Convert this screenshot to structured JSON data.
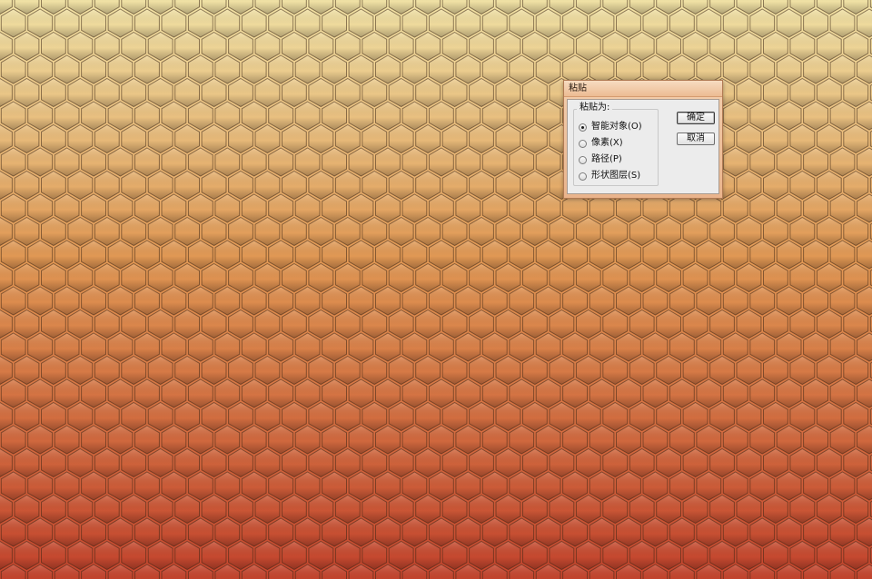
{
  "background": {
    "pattern": "hexagon-tiles",
    "gradient_top": "#F5E6A8",
    "gradient_mid": "#E59A55",
    "gradient_bottom": "#C8452E"
  },
  "dialog": {
    "title": "粘贴",
    "group_label": "粘贴为:",
    "options": [
      {
        "label": "智能对象(O)",
        "checked": true
      },
      {
        "label": "像素(X)",
        "checked": false
      },
      {
        "label": "路径(P)",
        "checked": false
      },
      {
        "label": "形状图层(S)",
        "checked": false
      }
    ],
    "ok_label": "确定",
    "cancel_label": "取消"
  }
}
